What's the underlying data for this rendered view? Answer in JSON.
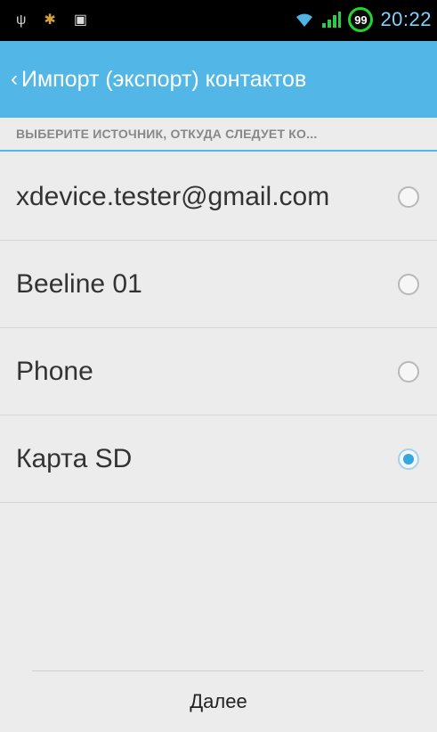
{
  "status_bar": {
    "clock": "20:22",
    "battery_level": "99",
    "icons": [
      "usb-icon",
      "bug-icon",
      "bag-icon",
      "wifi-icon",
      "signal-icon"
    ]
  },
  "action_bar": {
    "back_glyph": "‹",
    "title": "Импорт (экспорт) контактов"
  },
  "section": {
    "label": "ВЫБЕРИТЕ ИСТОЧНИК, ОТКУДА СЛЕДУЕТ КО..."
  },
  "sources": [
    {
      "label": "xdevice.tester@gmail.com",
      "checked": false
    },
    {
      "label": "Beeline 01",
      "checked": false
    },
    {
      "label": "Phone",
      "checked": false
    },
    {
      "label": "Карта SD",
      "checked": true
    }
  ],
  "footer": {
    "next_label": "Далее"
  },
  "colors": {
    "accent": "#52b7e6",
    "radio_checked": "#33a7e0",
    "battery_ring": "#22d42c"
  }
}
